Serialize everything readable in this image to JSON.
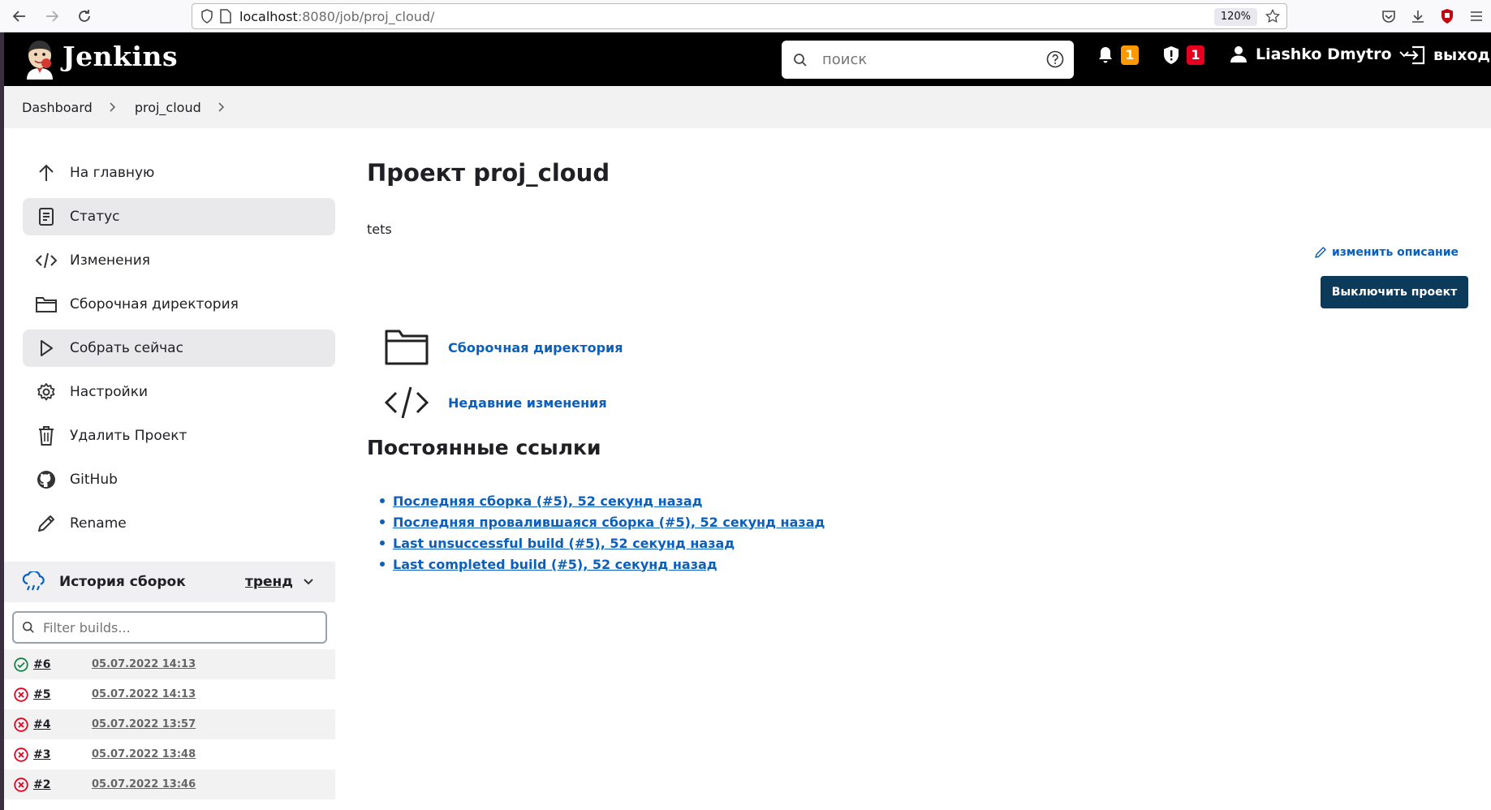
{
  "browser": {
    "url_host": "localhost",
    "url_rest": ":8080/job/proj_cloud/",
    "zoom": "120%"
  },
  "header": {
    "brand": "Jenkins",
    "search_placeholder": "поиск",
    "notifications_count": "1",
    "security_count": "1",
    "user_name": "Liashko Dmytro",
    "logout_label": "выход"
  },
  "breadcrumb": {
    "items": [
      "Dashboard",
      "proj_cloud"
    ]
  },
  "sidebar": {
    "tasks": [
      {
        "label": "На главную",
        "icon": "arrow-up-icon"
      },
      {
        "label": "Статус",
        "icon": "document-icon"
      },
      {
        "label": "Изменения",
        "icon": "code-icon"
      },
      {
        "label": "Сборочная директория",
        "icon": "folder-icon"
      },
      {
        "label": "Собрать сейчас",
        "icon": "play-icon"
      },
      {
        "label": "Настройки",
        "icon": "gear-icon"
      },
      {
        "label": "Удалить Проект",
        "icon": "trash-icon"
      },
      {
        "label": "GitHub",
        "icon": "github-icon"
      },
      {
        "label": "Rename",
        "icon": "pencil-icon"
      }
    ],
    "history": {
      "title": "История сборок",
      "trend_label": "тренд",
      "filter_placeholder": "Filter builds...",
      "builds": [
        {
          "number": "#6",
          "date": "05.07.2022 14:13",
          "status": "success"
        },
        {
          "number": "#5",
          "date": "05.07.2022 14:13",
          "status": "failed"
        },
        {
          "number": "#4",
          "date": "05.07.2022 13:57",
          "status": "failed"
        },
        {
          "number": "#3",
          "date": "05.07.2022 13:48",
          "status": "failed"
        },
        {
          "number": "#2",
          "date": "05.07.2022 13:46",
          "status": "failed"
        }
      ]
    }
  },
  "main": {
    "title": "Проект proj_cloud",
    "description": "tets",
    "edit_description_label": "изменить описание",
    "disable_button_label": "Выключить проект",
    "links": [
      {
        "label": "Сборочная директория",
        "icon": "folder-icon"
      },
      {
        "label": "Недавние изменения",
        "icon": "code-icon"
      }
    ],
    "permalinks_title": "Постоянные ссылки",
    "permalinks": [
      "Последняя сборка (#5), 52 секунд назад",
      "Последняя провалившаяся сборка (#5), 52 секунд назад",
      "Last unsuccessful build (#5), 52 секунд назад",
      "Last completed build (#5), 52 секунд назад"
    ]
  },
  "colors": {
    "header_bg": "#000000",
    "link": "#0b5fbd",
    "primary_button": "#0c3a5b",
    "success": "#138347",
    "failure": "#e6001f",
    "badge_orange": "#fe9a00",
    "badge_red": "#e6001f"
  }
}
